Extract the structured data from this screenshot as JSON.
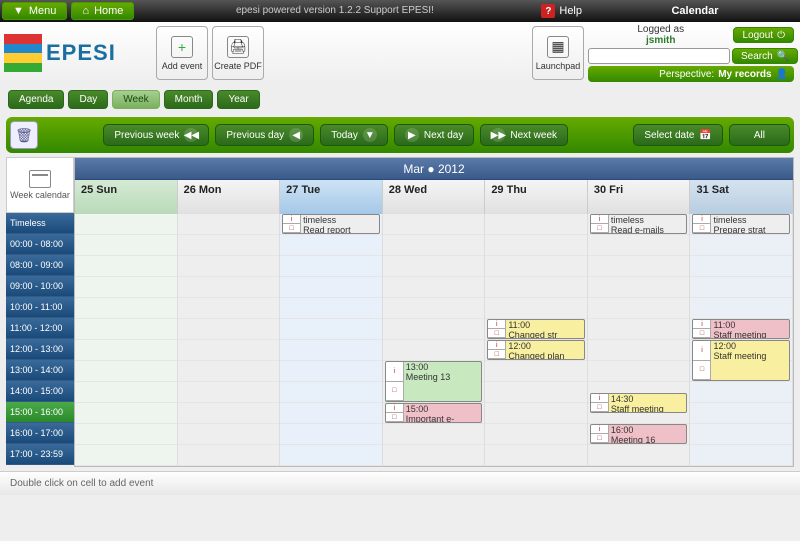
{
  "topbar": {
    "menu": "Menu",
    "home": "Home",
    "powered": "epesi powered  version 1.2.2   Support EPESI!",
    "help": "Help",
    "title": "Calendar"
  },
  "logo": "EPESI",
  "tools": {
    "add_event": "Add event",
    "create_pdf": "Create PDF",
    "launchpad": "Launchpad"
  },
  "user": {
    "logged_as": "Logged as",
    "name": "jsmith",
    "logout": "Logout",
    "search": "Search",
    "perspective_label": "Perspective:",
    "perspective_value": "My records"
  },
  "views": {
    "agenda": "Agenda",
    "day": "Day",
    "week": "Week",
    "month": "Month",
    "year": "Year"
  },
  "nav": {
    "prev_week": "Previous week",
    "prev_day": "Previous day",
    "today": "Today",
    "next_day": "Next day",
    "next_week": "Next week",
    "select_date": "Select date",
    "all": "All"
  },
  "sidebar": {
    "label": "Week calendar"
  },
  "month_header": "Mar  ●  2012",
  "days": [
    {
      "label": "25 Sun"
    },
    {
      "label": "26 Mon"
    },
    {
      "label": "27 Tue"
    },
    {
      "label": "28 Wed"
    },
    {
      "label": "29 Thu"
    },
    {
      "label": "30 Fri"
    },
    {
      "label": "31 Sat"
    }
  ],
  "time_slots": [
    "Timeless",
    "00:00 - 08:00",
    "08:00 - 09:00",
    "09:00 - 10:00",
    "10:00 - 11:00",
    "11:00 - 12:00",
    "12:00 - 13:00",
    "13:00 - 14:00",
    "14:00 - 15:00",
    "15:00 - 16:00",
    "16:00 - 17:00",
    "17:00 - 23:59"
  ],
  "current_slot": "15:00 - 16:00",
  "events": {
    "tue_timeless_time": "timeless",
    "tue_timeless_title": "Read report",
    "fri_timeless_time": "timeless",
    "fri_timeless_title": "Read e-mails",
    "sat_timeless_time": "timeless",
    "sat_timeless_title": "Prepare strat",
    "wed_13_time": "13:00",
    "wed_13_title": "Meeting 13",
    "wed_15_time": "15:00",
    "wed_15_title": "Important e-",
    "thu_11_time": "11:00",
    "thu_11_title": "Changed str",
    "thu_12_time": "12:00",
    "thu_12_title": "Changed plan",
    "fri_1430_time": "14:30",
    "fri_1430_title": "Staff meeting",
    "fri_16_time": "16:00",
    "fri_16_title": "Meeting 16",
    "sat_11_time": "11:00",
    "sat_11_title": "Staff meeting",
    "sat_12_time": "12:00",
    "sat_12_title": "Staff meeting"
  },
  "footer": "Double click on cell to add event"
}
